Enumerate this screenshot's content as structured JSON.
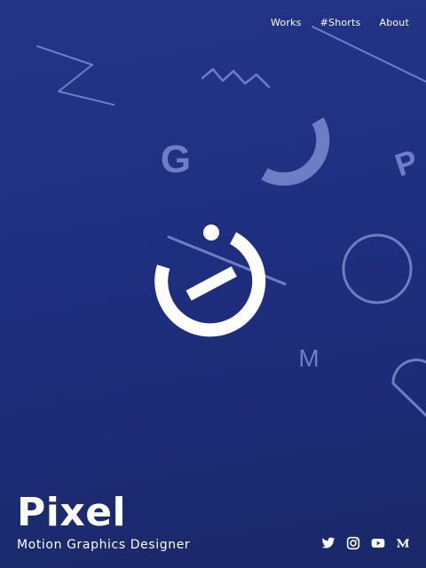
{
  "nav": {
    "items": [
      {
        "label": "Works"
      },
      {
        "label": "#Shorts"
      },
      {
        "label": "About"
      }
    ]
  },
  "hero": {
    "title": "Pixel",
    "subtitle": "Motion Graphics Designer"
  },
  "decor_letters": {
    "g": "G",
    "p": "P",
    "m": "M"
  },
  "social": {
    "icons": [
      "twitter-icon",
      "instagram-icon",
      "youtube-icon",
      "medium-icon"
    ]
  },
  "colors": {
    "background_top": "#243588",
    "background_bottom": "#1a2868",
    "accent_shapes": "#6f7ec4",
    "logo": "#ffffff",
    "text": "#ffffff"
  }
}
